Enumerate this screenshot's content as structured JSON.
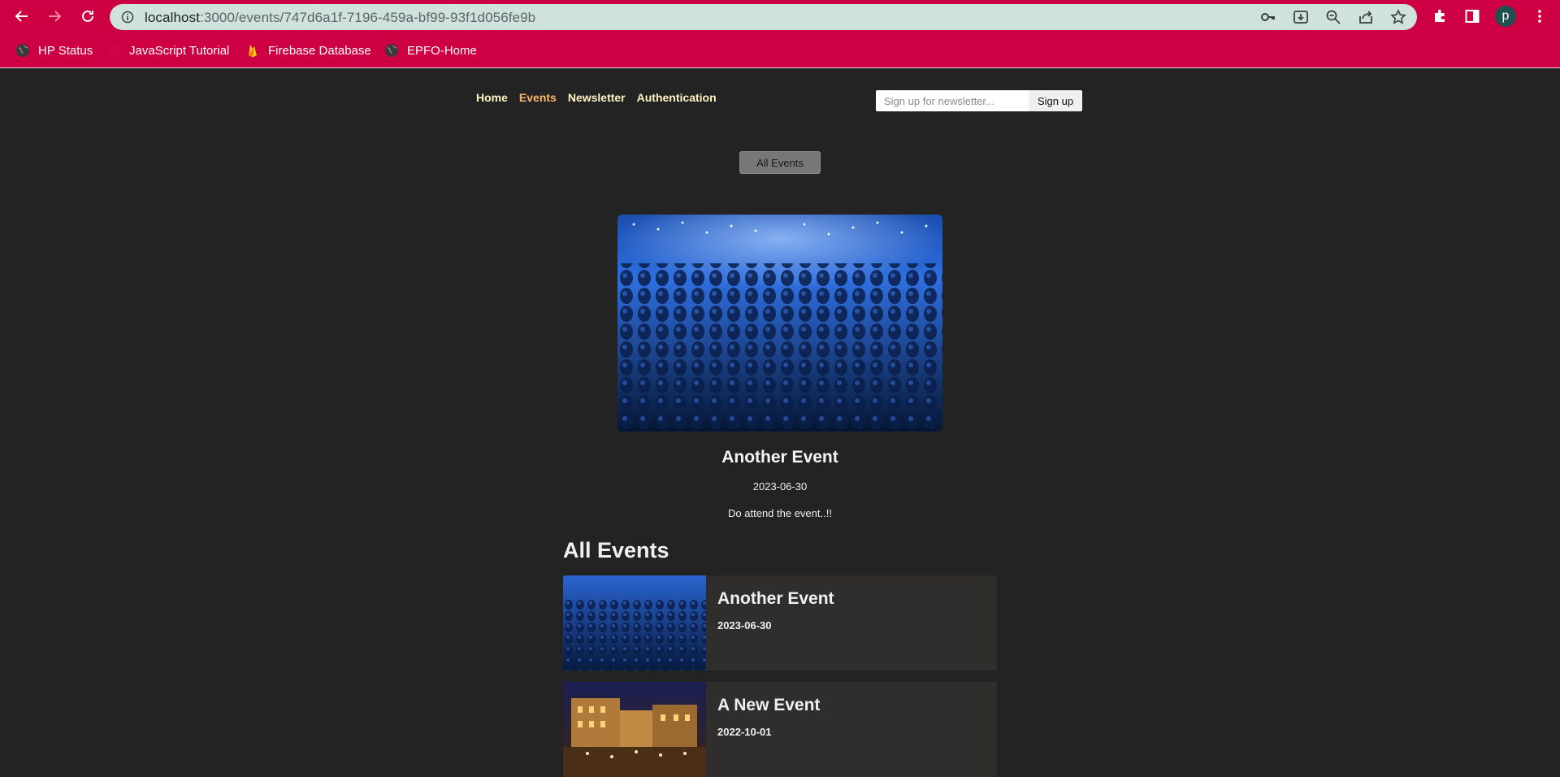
{
  "browser": {
    "url_host": "localhost",
    "url_path": ":3000/events/747d6a1f-7196-459a-bf99-93f1d056fe9b",
    "profile_initial": "p",
    "toolbar_color": "#cc0042",
    "bookmarks": [
      {
        "label": "HP Status",
        "icon": "globe-icon"
      },
      {
        "label": "JavaScript Tutorial",
        "icon": "js-icon"
      },
      {
        "label": "Firebase Database",
        "icon": "firebase-icon"
      },
      {
        "label": "EPFO-Home",
        "icon": "globe-icon"
      }
    ]
  },
  "nav": {
    "items": [
      {
        "label": "Home",
        "active": false
      },
      {
        "label": "Events",
        "active": true
      },
      {
        "label": "Newsletter",
        "active": false
      },
      {
        "label": "Authentication",
        "active": false
      }
    ]
  },
  "newsletter": {
    "placeholder": "Sign up for newsletter...",
    "button_label": "Sign up"
  },
  "events_nav": {
    "all_events_label": "All Events"
  },
  "event_detail": {
    "title": "Another Event",
    "date": "2023-06-30",
    "description": "Do attend the event..!!"
  },
  "events_list": {
    "heading": "All Events",
    "items": [
      {
        "title": "Another Event",
        "date": "2023-06-30"
      },
      {
        "title": "A New Event",
        "date": "2022-10-01"
      }
    ]
  },
  "colors": {
    "page_bg": "#232323",
    "nav_link": "#fff2c6",
    "nav_active": "#fcb66b",
    "card_bg": "#2f2e2c"
  }
}
